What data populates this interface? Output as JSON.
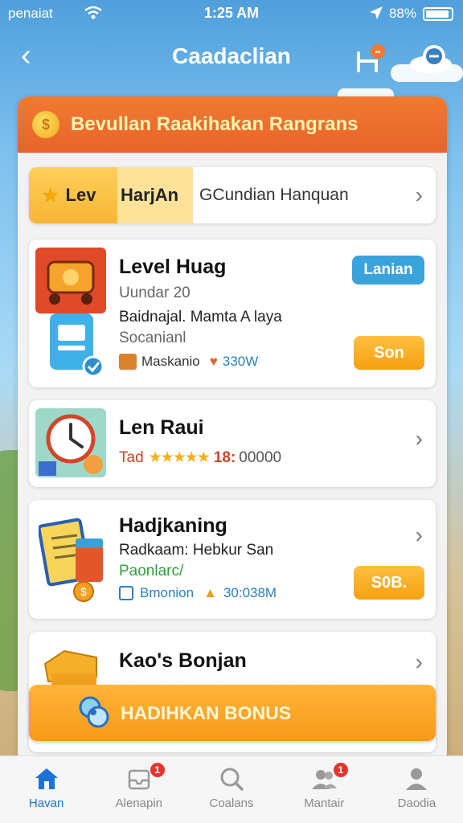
{
  "status": {
    "carrier": "penaiat",
    "time": "1:25 AM",
    "battery": "88%"
  },
  "header": {
    "title": "Caadaclian"
  },
  "banner": {
    "coin_symbol": "$",
    "text": "Bevullan Raakihakan Rangrans"
  },
  "level_bar": {
    "seg1": "Lev",
    "seg2": "HarjAn",
    "seg3": "GCundian Hanquan"
  },
  "items": [
    {
      "name": "Level Huag",
      "line1": "Uundar 20",
      "line2": "Baidnajal. Mamta A laya",
      "line3": "Socanianl",
      "meta_label": "Maskanio",
      "meta_value": "330W",
      "badge": "Lanian",
      "action": "Son"
    },
    {
      "name": "Len Raui",
      "rating_prefix": "Tad",
      "rating_value": "18:",
      "rating_count": "00000",
      "rating_stars": 5
    },
    {
      "name": "Hadjkaning",
      "line1": "Radkaam: Hebkur San",
      "line2": "Paonlarc/",
      "meta_label": "Bmonion",
      "meta_value": "30:038M",
      "action": "S0B."
    },
    {
      "name": "Kao's Bonjan"
    }
  ],
  "bonus": {
    "label": "HADIHKAN BONUS"
  },
  "tabs": [
    {
      "label": "Havan",
      "badge": "",
      "icon": "home-icon",
      "active": true
    },
    {
      "label": "Alenapin",
      "badge": "1",
      "icon": "inbox-icon",
      "active": false
    },
    {
      "label": "Coalans",
      "badge": "",
      "icon": "search-icon",
      "active": false
    },
    {
      "label": "Mantair",
      "badge": "1",
      "icon": "people-icon",
      "active": false
    },
    {
      "label": "Daodia",
      "badge": "",
      "icon": "profile-icon",
      "active": false
    }
  ],
  "colors": {
    "accent_orange": "#f07a32",
    "accent_blue": "#3aa3dc",
    "active_tab": "#1a73d9"
  }
}
